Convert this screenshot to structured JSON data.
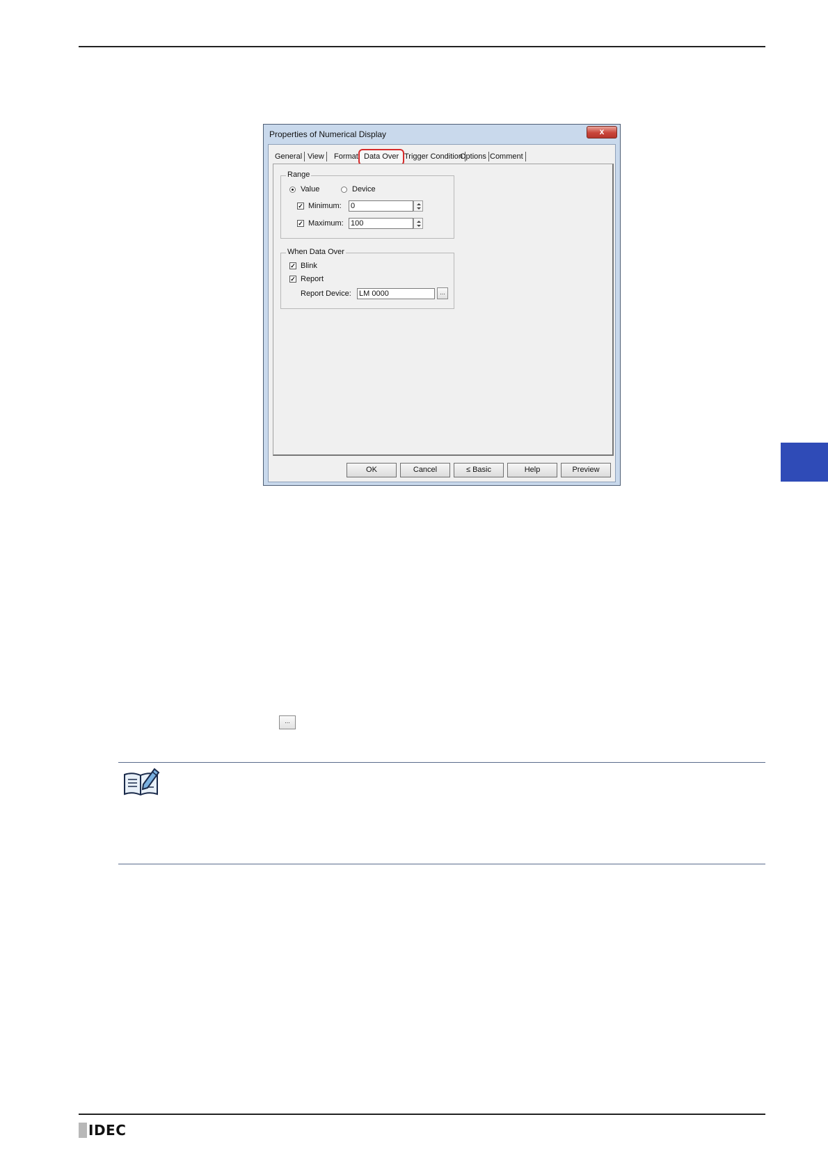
{
  "dialog": {
    "title": "Properties of Numerical Display",
    "close_glyph": "x",
    "tabs": [
      "General",
      "View",
      "Format",
      "Data Over",
      "Trigger Condition",
      "Options",
      "Comment"
    ],
    "active_tab": "Data Over",
    "range": {
      "label": "Range",
      "value_radio": "Value",
      "device_radio": "Device",
      "selected": "Value",
      "minimum_label": "Minimum:",
      "minimum_checked": true,
      "minimum_value": "0",
      "maximum_label": "Maximum:",
      "maximum_checked": true,
      "maximum_value": "100"
    },
    "when_data_over": {
      "label": "When Data Over",
      "blink_label": "Blink",
      "blink_checked": true,
      "report_label": "Report",
      "report_checked": true,
      "report_device_label": "Report Device:",
      "report_device_value": "LM 0000",
      "browse_label": "..."
    },
    "buttons": {
      "ok": "OK",
      "cancel": "Cancel",
      "basic": "≤ Basic",
      "help": "Help",
      "preview": "Preview"
    }
  },
  "inline_browse_label": "...",
  "footer": {
    "logo_text": "IDEC"
  },
  "colors": {
    "side_tab": "#2f4bb7",
    "active_tab_highlight": "#d52b2b"
  },
  "icons": {
    "note": "note-pencil-icon",
    "close": "close-icon"
  }
}
